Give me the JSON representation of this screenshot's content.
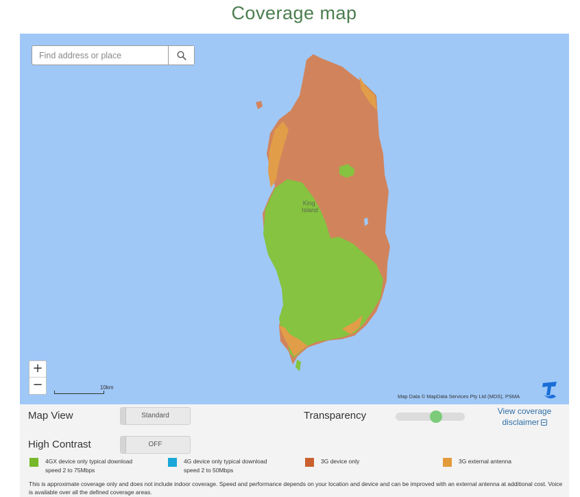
{
  "page": {
    "title": "Coverage map"
  },
  "search": {
    "placeholder": "Find address or place",
    "icon": "search-icon"
  },
  "map": {
    "place_label_line1": "King",
    "place_label_line2": "Island",
    "zoom_in_label": "+",
    "zoom_out_label": "−",
    "scale_label": "10km",
    "attribution": "Map Data © MapData Services Pty Ltd (MDS), PSMA",
    "brand_logo": "telstra-logo",
    "colors": {
      "water": "#9fc8f7",
      "coverage_4gx": "#85c340",
      "coverage_3g": "#d1845c",
      "coverage_3g_external": "#e29d48"
    }
  },
  "controls": {
    "map_view_label": "Map View",
    "map_view_value": "Standard",
    "high_contrast_label": "High Contrast",
    "high_contrast_value": "OFF",
    "transparency_label": "Transparency",
    "transparency_value": 0.6,
    "disclaimer_line1": "View coverage",
    "disclaimer_line2": "disclaimer"
  },
  "legend": [
    {
      "color": "#76b82a",
      "label": "4GX device only typical download speed 2 to 75Mbps"
    },
    {
      "color": "#1ba7d8",
      "label": "4G device only typical download speed 2 to 50Mbps"
    },
    {
      "color": "#c9602f",
      "label": "3G device only"
    },
    {
      "color": "#e39a3a",
      "label": "3G external antenna"
    }
  ],
  "footnote": "This is approximate coverage only and does not include indoor coverage. Speed and performance depends on your location and device and can be improved with an external antenna at additional cost. Voice is available over all the defined coverage areas."
}
